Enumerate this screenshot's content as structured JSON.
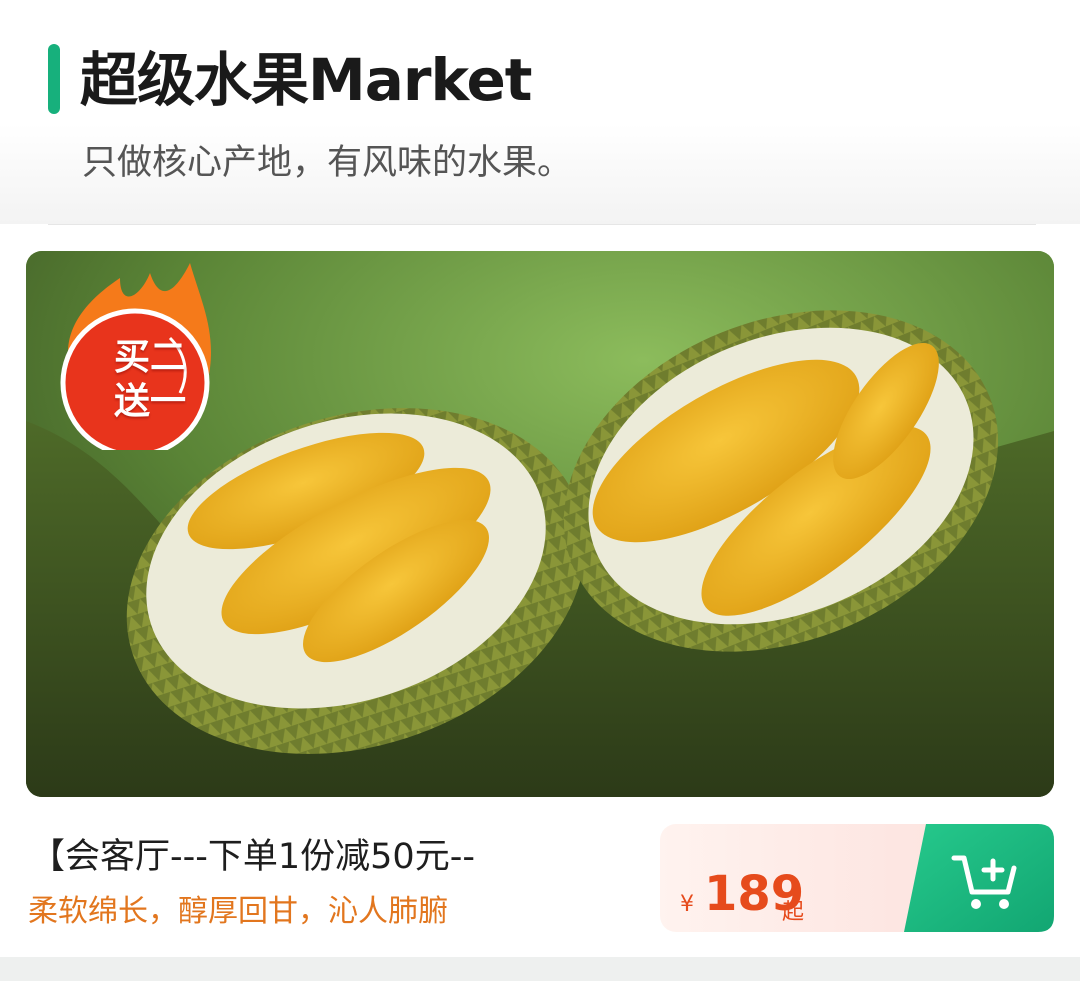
{
  "header": {
    "title": "超级水果Market",
    "subtitle": "只做核心产地，有风味的水果。"
  },
  "product": {
    "promo_line1": "买二",
    "promo_line2": "送一",
    "name": "【会客厅---下单1份减50元--",
    "description": "柔软绵长，醇厚回甘，沁人肺腑",
    "price_currency": "¥",
    "price_value": "189",
    "price_suffix": "起"
  },
  "colors": {
    "accent": "#17b07c",
    "price": "#e64b1c",
    "description": "#e2761e",
    "promo_badge": "#e8341c"
  },
  "icons": {
    "cart": "add-to-cart-icon",
    "promo": "flame-badge-icon"
  }
}
